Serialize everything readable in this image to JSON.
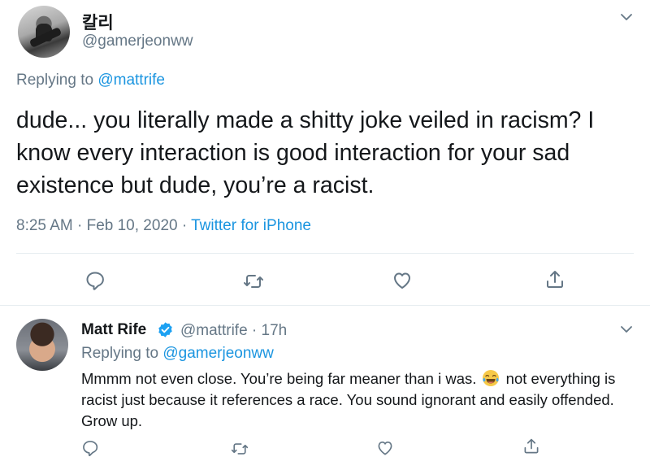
{
  "tweet1": {
    "display_name": "칼리",
    "handle": "@gamerjeonww",
    "replying_prefix": "Replying to",
    "replying_to": "@mattrife",
    "text": "dude... you literally made a shitty joke veiled in racism? I know every interaction is good interaction for your sad existence but dude, you’re a racist.",
    "timestamp": "8:25 AM · Feb 10, 2020 · ",
    "source": "Twitter for iPhone"
  },
  "tweet2": {
    "display_name": "Matt Rife",
    "handle_time": "@mattrife · 17h",
    "replying_prefix": "Replying to",
    "replying_to": "@gamerjeonww",
    "text_before_emoji": "Mmmm not even close. You’re being far meaner than i was.",
    "emoji": "joy-emoji",
    "text_after_emoji": "not everything is racist just because it references a race. You sound ignorant and easily offended. Grow up."
  },
  "colors": {
    "link": "#1b95e0",
    "secondary_text": "#657786",
    "verified": "#1da1f2"
  },
  "icons": [
    "chevron-down-icon",
    "reply-icon",
    "retweet-icon",
    "like-icon",
    "share-icon",
    "verified-badge-icon"
  ]
}
